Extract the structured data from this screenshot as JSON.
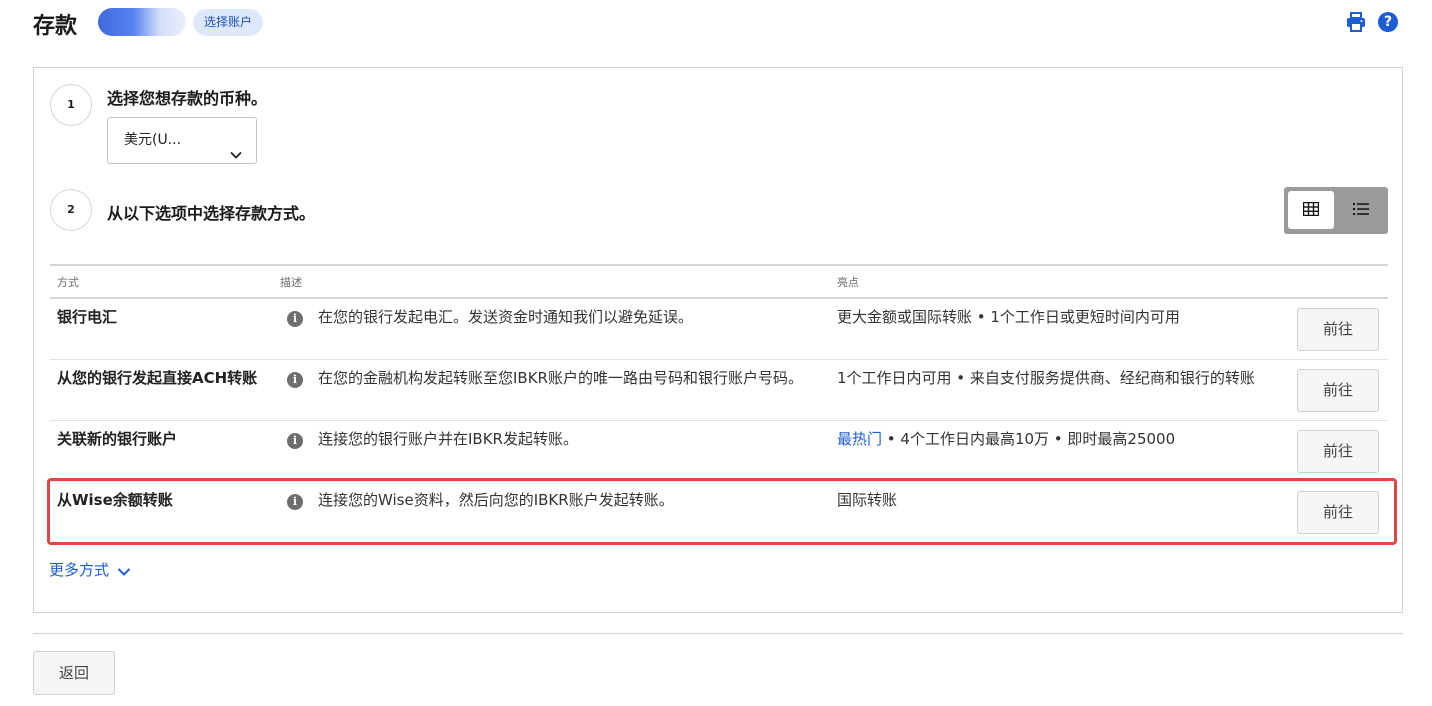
{
  "header": {
    "title": "存款",
    "select_account_label": "选择账户"
  },
  "step1": {
    "number": "1",
    "title": "选择您想存款的币种。",
    "currency_selected": "美元(U..."
  },
  "step2": {
    "number": "2",
    "title": "从以下选项中选择存款方式。"
  },
  "table": {
    "columns": [
      "方式",
      "描述",
      "亮点"
    ],
    "rows": [
      {
        "method": "银行电汇",
        "description": "在您的银行发起电汇。发送资金时通知我们以避免延误。",
        "highlight_prefix": "",
        "highlight": "更大金额或国际转账 • 1个工作日或更短时间内可用",
        "action": "前往"
      },
      {
        "method": "从您的银行发起直接ACH转账",
        "description": "在您的金融机构发起转账至您IBKR账户的唯一路由号码和银行账户号码。",
        "highlight_prefix": "",
        "highlight": "1个工作日内可用 • 来自支付服务提供商、经纪商和银行的转账",
        "action": "前往"
      },
      {
        "method": "关联新的银行账户",
        "description": "连接您的银行账户并在IBKR发起转账。",
        "highlight_prefix": "最热门",
        "highlight": " • 4个工作日内最高10万 • 即时最高25000",
        "action": "前往"
      },
      {
        "method": "从Wise余额转账",
        "description": "连接您的Wise资料，然后向您的IBKR账户发起转账。",
        "highlight_prefix": "",
        "highlight": "国际转账",
        "action": "前往"
      }
    ]
  },
  "more_methods_label": "更多方式",
  "back_label": "返回",
  "icons": {
    "print": "printer-icon",
    "help": "help-icon",
    "info": "info-icon",
    "grid_view": "grid-icon",
    "list_view": "list-icon",
    "chevron": "chevron-down-icon"
  },
  "colors": {
    "accent": "#1d5ed6",
    "highlight_border": "#e04646"
  }
}
